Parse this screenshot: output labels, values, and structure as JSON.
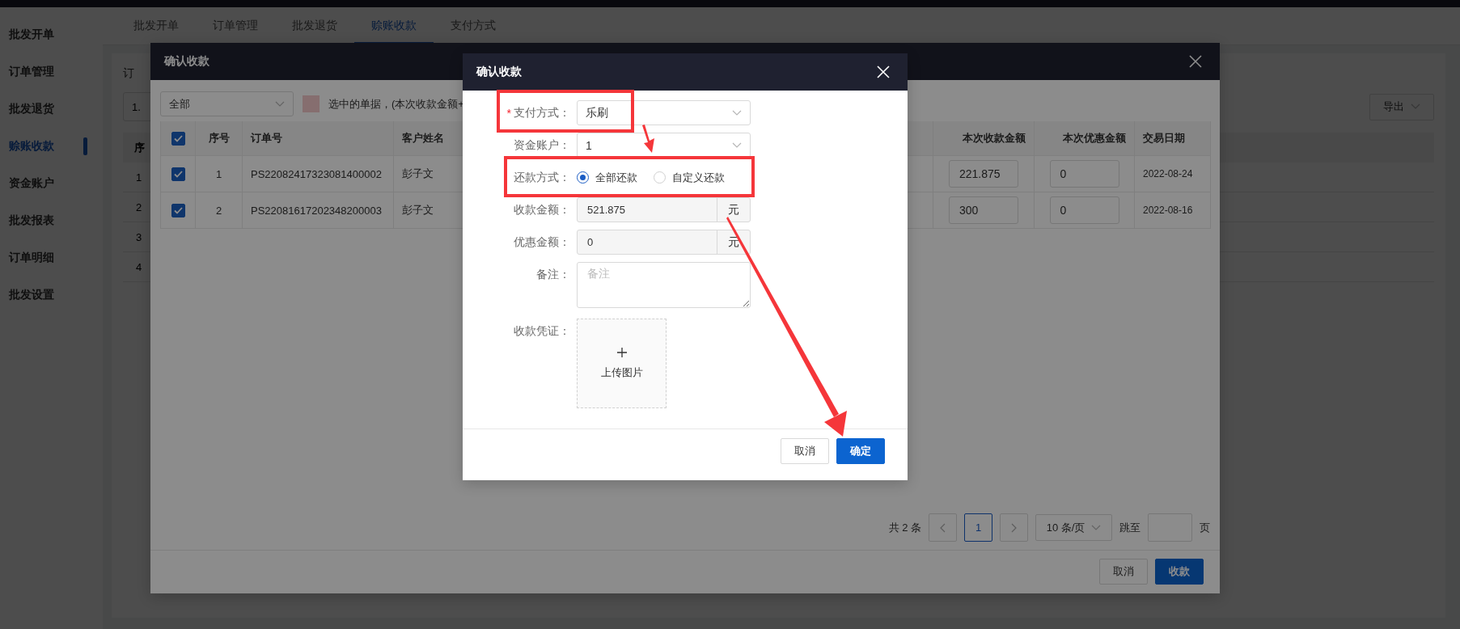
{
  "sidebar": {
    "items": [
      {
        "label": "批发开单",
        "selected": false
      },
      {
        "label": "订单管理",
        "selected": false
      },
      {
        "label": "批发退货",
        "selected": false
      },
      {
        "label": "赊账收款",
        "selected": true
      },
      {
        "label": "资金账户",
        "selected": false
      },
      {
        "label": "批发报表",
        "selected": false
      },
      {
        "label": "订单明细",
        "selected": false
      },
      {
        "label": "批发设置",
        "selected": false
      }
    ]
  },
  "tabs": [
    {
      "label": "批发开单",
      "selected": false
    },
    {
      "label": "订单管理",
      "selected": false
    },
    {
      "label": "批发退货",
      "selected": false
    },
    {
      "label": "赊账收款",
      "selected": true
    },
    {
      "label": "支付方式",
      "selected": false
    }
  ],
  "background_page": {
    "filter_label": "订",
    "date_field_value": "1.",
    "export_button": "导出",
    "table": {
      "column_1": "序",
      "rows": [
        "1",
        "2",
        "3",
        "4"
      ]
    }
  },
  "receipt_dialog": {
    "title": "确认收款",
    "status_select": "全部",
    "legend_text": "选中的单据，(本次收款金额+",
    "select_all_checked": true,
    "table": {
      "columns": [
        "序号",
        "订单号",
        "客户姓名",
        "本次收款金额",
        "本次优惠金额",
        "交易日期"
      ],
      "rows": [
        {
          "checked": true,
          "index": "1",
          "order_no": "PS22082417323081400002",
          "customer": "彭子文",
          "receipt_amount": "221.875",
          "discount_amount": "0",
          "date": "2022-08-24"
        },
        {
          "checked": true,
          "index": "2",
          "order_no": "PS22081617202348200003",
          "customer": "彭子文",
          "receipt_amount": "300",
          "discount_amount": "0",
          "date": "2022-08-16"
        }
      ]
    },
    "pagination": {
      "total": "共 2 条",
      "pages": [
        {
          "label": "1",
          "selected": true
        }
      ],
      "page_size": "10 条/页",
      "jump_label": "跳至",
      "page_suffix": "页"
    },
    "buttons": [
      {
        "label": "取消",
        "kind": "default"
      },
      {
        "label": "收款",
        "kind": "primary"
      }
    ]
  },
  "confirm_dialog": {
    "title": "确认收款",
    "fields": [
      {
        "kind": "select",
        "label": "支付方式：",
        "required_mark": "*",
        "value": "乐刷"
      },
      {
        "kind": "select",
        "label": "资金账户：",
        "value": "1"
      },
      {
        "kind": "radio",
        "label": "还款方式：",
        "options": [
          {
            "label": "全部还款",
            "selected": true
          },
          {
            "label": "自定义还款",
            "selected": false
          }
        ]
      },
      {
        "kind": "amount",
        "label": "收款金额：",
        "value": "521.875",
        "unit": "元"
      },
      {
        "kind": "amount",
        "label": "优惠金额：",
        "value": "0",
        "unit": "元"
      },
      {
        "kind": "textarea",
        "label": "备注：",
        "placeholder": "备注"
      },
      {
        "kind": "upload",
        "label": "收款凭证：",
        "text": "上传图片"
      }
    ],
    "buttons": [
      {
        "label": "取消",
        "kind": "default"
      },
      {
        "label": "确定",
        "kind": "primary"
      }
    ]
  }
}
